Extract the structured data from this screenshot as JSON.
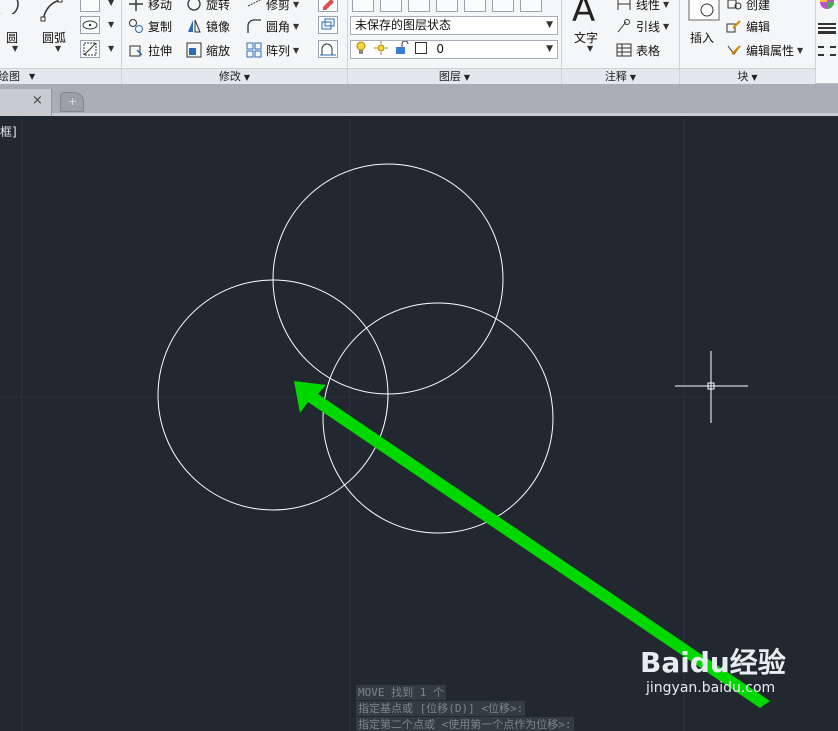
{
  "ribbon": {
    "draw": {
      "circle_label": "圆",
      "arc_label": "圆弧",
      "title": "绘图"
    },
    "modify": {
      "move": "移动",
      "rotate": "旋转",
      "trim": "修剪",
      "copy": "复制",
      "mirror": "镜像",
      "fillet": "圆角",
      "stretch": "拉伸",
      "scale": "缩放",
      "array": "阵列",
      "title": "修改"
    },
    "layers": {
      "layer_state": "未保存的图层状态",
      "current_layer": "0",
      "title": "图层"
    },
    "annotation": {
      "text": "文字",
      "linear": "线性",
      "leader": "引线",
      "table": "表格",
      "title": "注释"
    },
    "block": {
      "insert": "插入",
      "create": "创建",
      "edit": "编辑",
      "edit_attributes": "编辑属性",
      "title": "块"
    }
  },
  "tabs": {
    "close_icon": "×",
    "new_tab_icon": "+"
  },
  "canvas": {
    "view_label": "框]",
    "command_history": [
      "MOVE 找到 1 个",
      "指定基点或 [位移(D)] <位移>:",
      "指定第二个点或 <使用第一个点作为位移>:"
    ],
    "background": "#212830",
    "geometry_color": "#ffffff",
    "arrow_color": "#00d800"
  },
  "watermark": {
    "main": "Baidu经验",
    "sub": "jingyan.baidu.com"
  }
}
